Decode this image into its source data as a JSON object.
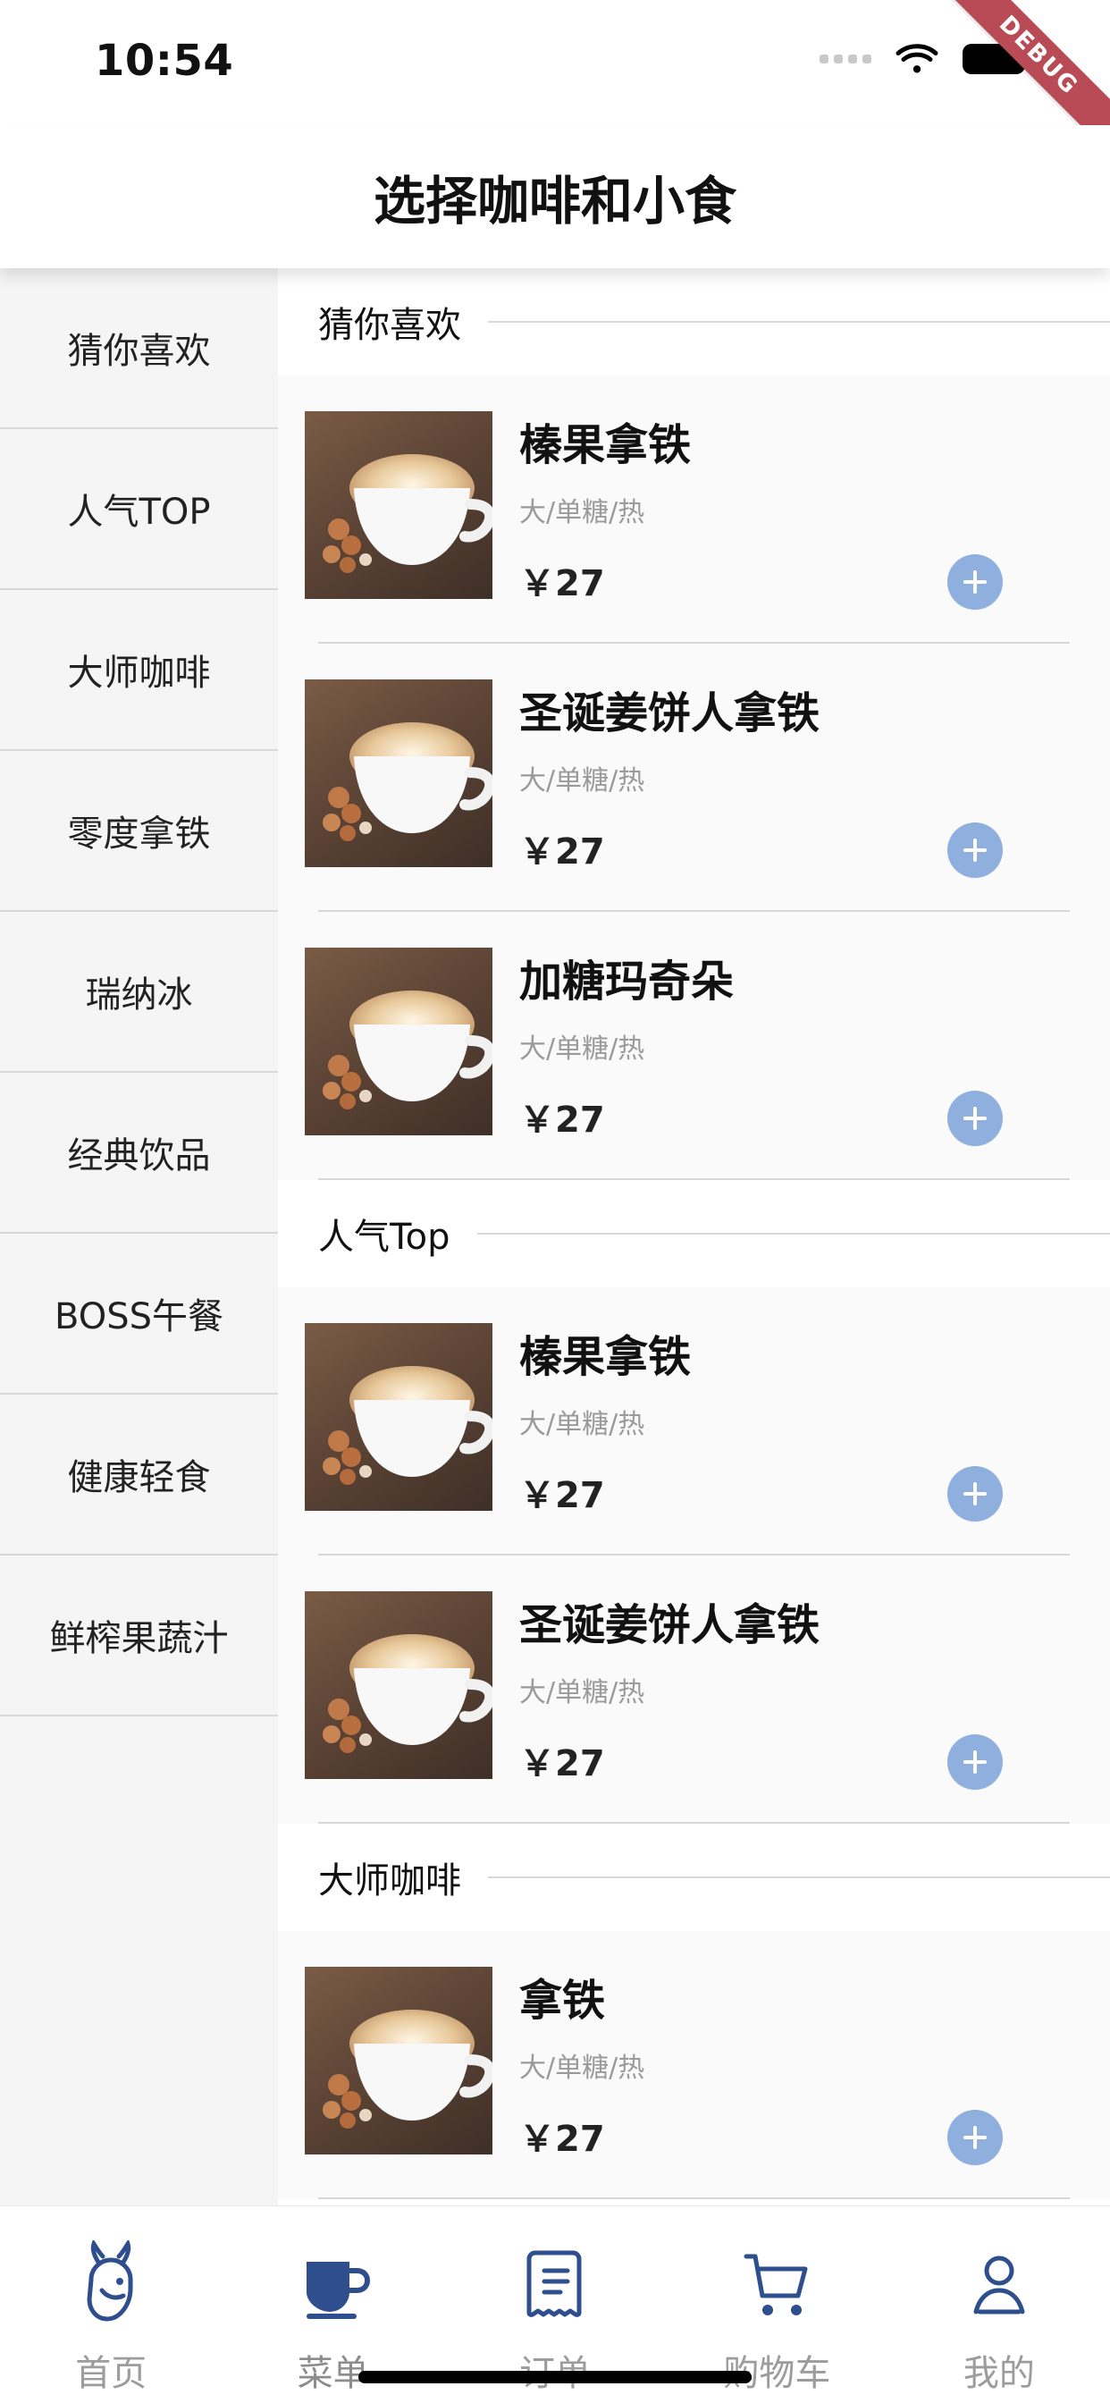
{
  "status_bar": {
    "time": "10:54",
    "debug_label": "DEBUG"
  },
  "header": {
    "title": "选择咖啡和小食"
  },
  "sidebar": {
    "items": [
      {
        "label": "猜你喜欢"
      },
      {
        "label": "人气TOP"
      },
      {
        "label": "大师咖啡"
      },
      {
        "label": "零度拿铁"
      },
      {
        "label": "瑞纳冰"
      },
      {
        "label": "经典饮品"
      },
      {
        "label": "BOSS午餐"
      },
      {
        "label": "健康轻食"
      },
      {
        "label": "鲜榨果蔬汁"
      }
    ]
  },
  "sections": [
    {
      "title": "猜你喜欢",
      "items": [
        {
          "name": "榛果拿铁",
          "options": "大/单糖/热",
          "price": "￥27"
        },
        {
          "name": "圣诞姜饼人拿铁",
          "options": "大/单糖/热",
          "price": "￥27"
        },
        {
          "name": "加糖玛奇朵",
          "options": "大/单糖/热",
          "price": "￥27"
        }
      ]
    },
    {
      "title": "人气Top",
      "items": [
        {
          "name": "榛果拿铁",
          "options": "大/单糖/热",
          "price": "￥27"
        },
        {
          "name": "圣诞姜饼人拿铁",
          "options": "大/单糖/热",
          "price": "￥27"
        }
      ]
    },
    {
      "title": "大师咖啡",
      "items": [
        {
          "name": "拿铁",
          "options": "大/单糖/热",
          "price": "￥27"
        }
      ]
    }
  ],
  "bottom_nav": {
    "items": [
      {
        "label": "首页",
        "icon": "deer-icon"
      },
      {
        "label": "菜单",
        "icon": "coffee-cup-icon"
      },
      {
        "label": "订单",
        "icon": "receipt-icon"
      },
      {
        "label": "购物车",
        "icon": "cart-icon"
      },
      {
        "label": "我的",
        "icon": "user-icon"
      }
    ]
  },
  "colors": {
    "accent": "#8FB0DF",
    "nav_icon": "#2F4E8E",
    "debug_ribbon": "#B84B55"
  }
}
